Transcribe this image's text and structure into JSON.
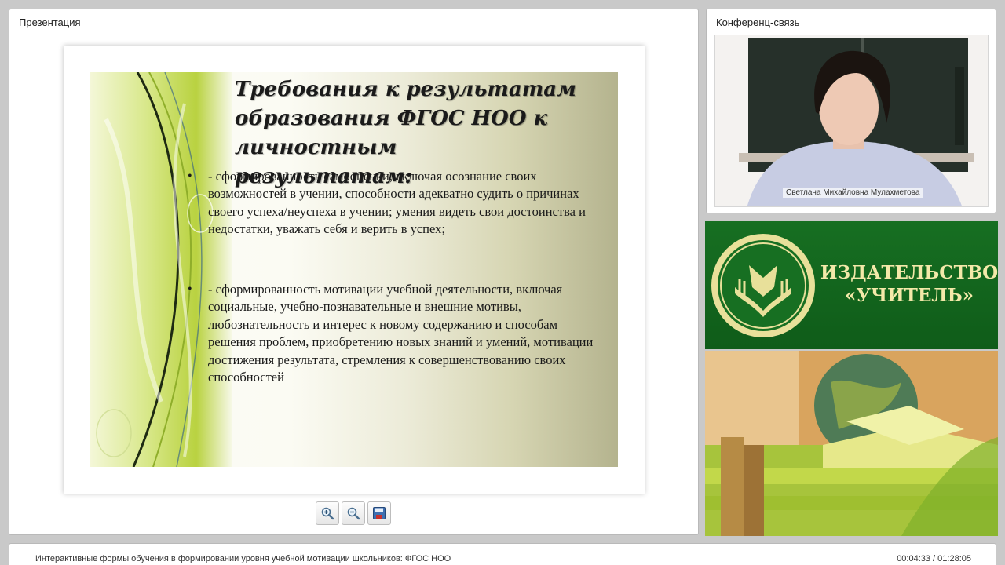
{
  "presentation": {
    "panel_title": "Презентация",
    "slide": {
      "title": "Требования к результатам образования ФГОС НОО к личностным результатам:",
      "bullets": [
        {
          "marker": "•",
          "text": "- сформированность самооценки, включая осознание своих возможностей в учении, способности адекватно судить о причинах своего успеха/неуспеха в учении; умения видеть свои достоинства и недостатки, уважать себя и верить в успех;"
        },
        {
          "marker": "•",
          "text": " - сформированность мотивации учебной деятельности, включая социальные, учебно-познавательные и внешние мотивы, любознательность и интерес к новому содержанию и способам решения проблем, приобретению новых знаний и умений, мотивации достижения результата, стремления к совершенствованию своих способностей"
        }
      ]
    },
    "toolbar": {
      "zoom_in_icon": "zoom-in-icon",
      "zoom_out_icon": "zoom-out-icon",
      "save_icon": "floppy-disk-icon"
    }
  },
  "conference": {
    "panel_title": "Конференц-связь",
    "speaker_name": "Светлана Михайловна Мулахметова"
  },
  "ad": {
    "publisher_name": "ИЗДАТЕЛЬСТВО\n«УЧИТЕЛЬ»",
    "brand_color": "#176f22",
    "text_color": "#f3e9a9"
  },
  "footer": {
    "webinar_title": "Интерактивные формы обучения в формировании уровня учебной мотивации школьников: ФГОС НОО",
    "time": "00:04:33 / 01:28:05"
  }
}
